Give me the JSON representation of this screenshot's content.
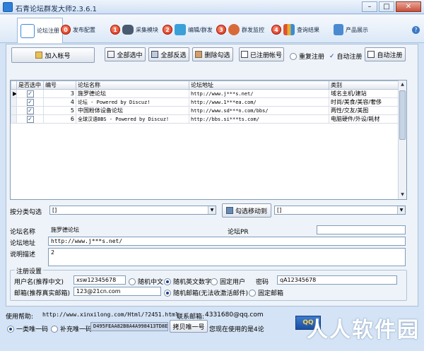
{
  "window": {
    "title": "石青论坛群发大师2.3.6.1",
    "controls": [
      "–",
      "□",
      "✕"
    ]
  },
  "tabs": [
    {
      "label": "论坛注册",
      "badge": "",
      "icon": "document-icon",
      "color": "#3a8ad8"
    },
    {
      "label": "发布配置",
      "badge": "0",
      "icon": "publish-icon",
      "color": "#e05030"
    },
    {
      "label": "采集模块",
      "badge": "1",
      "icon": "binoculars-icon",
      "color": "#5a6a80"
    },
    {
      "label": "编辑/群发",
      "badge": "2",
      "icon": "edit-icon",
      "color": "#3aa0d8"
    },
    {
      "label": "群发监控",
      "badge": "3",
      "icon": "monitor-icon",
      "color": "#d86a3a"
    },
    {
      "label": "查询结果",
      "badge": "4",
      "icon": "chart-icon",
      "color": "#e0b030"
    },
    {
      "label": "产品展示",
      "badge": "",
      "icon": "product-icon",
      "color": "#4a8ad0"
    }
  ],
  "help": "?",
  "actions": {
    "add_account": "加入帐号",
    "select_all": "全部选中",
    "invert_select": "全部反选",
    "delete_checked": "删除勾选",
    "registered_accounts": "已注册帐号",
    "repeat_register": "重复注册",
    "auto_register_check": "自动注册",
    "auto_register_btn": "自动注册"
  },
  "table": {
    "columns": [
      "是否选中",
      "编号",
      "论坛名称",
      "论坛地址",
      "类别"
    ],
    "rows": [
      {
        "checked": "✓",
        "id": "3",
        "name": "施罗德论坛",
        "url": "http://www.j***s.net/",
        "category": "域名主机/建站",
        "current": "▶"
      },
      {
        "checked": "✓",
        "id": "4",
        "name": "论坛 - Powered by Discuz!",
        "url": "http://www.1***ea.com/",
        "category": "时尚/美食/美容/奢侈",
        "current": ""
      },
      {
        "checked": "✓",
        "id": "5",
        "name": "中国粉体设备论坛",
        "url": "http://www.sd***n.com/bbs/",
        "category": "两性/交友/美图",
        "current": ""
      },
      {
        "checked": "✓",
        "id": "6",
        "name": "全球汉语BBS - Powered by Discuz!",
        "url": "http://bbs.si***ts.com/",
        "category": "电脑硬件/外设/耗材",
        "current": ""
      }
    ]
  },
  "category_filter": {
    "label": "按分类勾选",
    "value": "[]"
  },
  "move_category": {
    "label": "勾选移动到",
    "value": "[]"
  },
  "detail": {
    "name_label": "论坛名称",
    "name_value": "施罗德论坛",
    "pr_label": "论坛PR",
    "pr_value": "",
    "url_label": "论坛地址",
    "url_value": "http://www.j***s.net/",
    "desc_label": "说明描述",
    "desc_value": "2"
  },
  "register": {
    "group_title": "注册设置",
    "username_label": "用户名(推荐中文)",
    "username_value": "xsw12345678",
    "random_cn": "随机中文",
    "random_en_num": "随机英文数字",
    "fixed_user": "固定用户",
    "password_label": "密码",
    "password_value": "qA12345678",
    "email_label": "邮箱(推荐真实邮箱)",
    "email_value": "123@21cn.com",
    "random_email": "随机邮箱(无法收激活邮件)",
    "fixed_email": "固定邮箱"
  },
  "status": {
    "help_label": "使用帮助:",
    "help_url": "http://www.xinxilong.com/Html/?2451.html",
    "contact_label": "联系邮箱:",
    "contact_value": "4331680@qq.com",
    "code_type_1": "一类唯一码",
    "code_type_2": "补充唯一码",
    "machine_code": "D495FEAA82B8A4A998413TD8E0",
    "copy_code": "拷贝唯一号",
    "usage_prefix": "您现在使用的是4论",
    "promo": "QQ",
    "watermark": "人人软件园"
  }
}
